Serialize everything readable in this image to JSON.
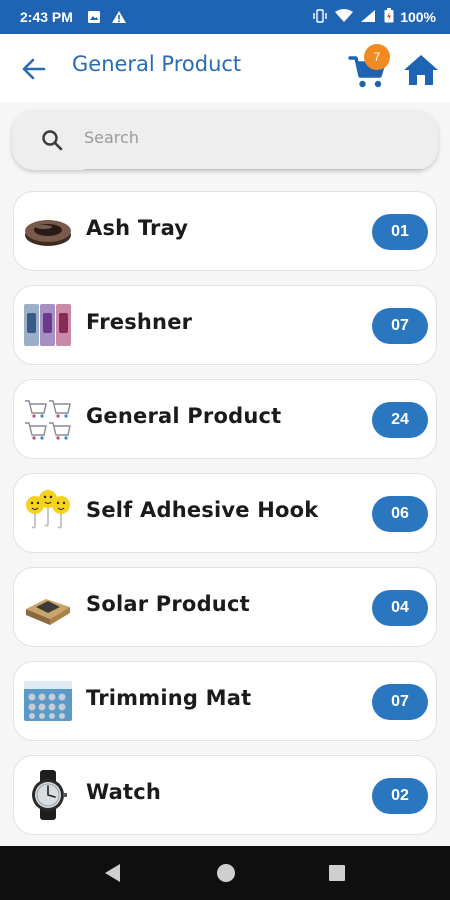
{
  "status": {
    "time": "2:43 PM",
    "battery": "100%"
  },
  "appbar": {
    "title": "General Product",
    "cart_count": "7"
  },
  "search": {
    "placeholder": "Search"
  },
  "items": [
    {
      "label": "Ash Tray",
      "count": "01"
    },
    {
      "label": "Freshner",
      "count": "07"
    },
    {
      "label": "General Product",
      "count": "24"
    },
    {
      "label": "Self Adhesive Hook",
      "count": "06"
    },
    {
      "label": "Solar Product",
      "count": "04"
    },
    {
      "label": "Trimming Mat",
      "count": "07"
    },
    {
      "label": "Watch",
      "count": "02"
    }
  ],
  "colors": {
    "primary": "#2a6bb2",
    "badge": "#2a76bf",
    "accent": "#f08a21",
    "statusbar": "#1f64b3"
  },
  "icons": [
    "back-arrow-icon",
    "cart-icon",
    "home-icon",
    "search-icon",
    "nav-back-icon",
    "nav-home-icon",
    "nav-recents-icon"
  ]
}
